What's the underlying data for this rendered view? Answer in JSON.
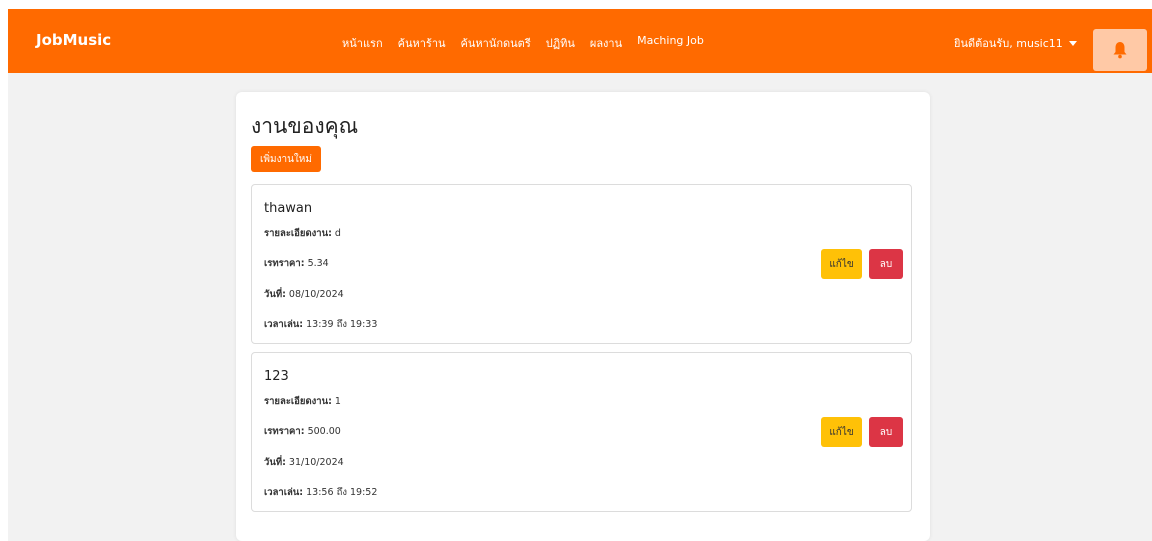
{
  "navbar": {
    "brand": "JobMusic",
    "links": [
      "หน้าแรก",
      "ค้นหาร้าน",
      "ค้นหานักดนตรี",
      "ปฏิทิน",
      "ผลงาน",
      "Maching Job"
    ],
    "user_greeting": "ยินดีต้อนรับ, music11",
    "bell_icon": "bell-icon",
    "accent_color": "#ff6a00"
  },
  "main": {
    "title": "งานของคุณ",
    "add_button": "เพิ่มงานใหม่"
  },
  "labels": {
    "detail": "รายละเอียดงาน:",
    "rate": "เรทราคา:",
    "date": "วันที่:",
    "time": "เวลาเล่น:",
    "time_sep": "ถึง",
    "edit": "แก้ไข",
    "delete": "ลบ"
  },
  "jobs": [
    {
      "title": "thawan",
      "detail": "d",
      "rate": "5.34",
      "date": "08/10/2024",
      "time_start": "13:39",
      "time_end": "19:33"
    },
    {
      "title": "123",
      "detail": "1",
      "rate": "500.00",
      "date": "31/10/2024",
      "time_start": "13:56",
      "time_end": "19:52"
    }
  ]
}
